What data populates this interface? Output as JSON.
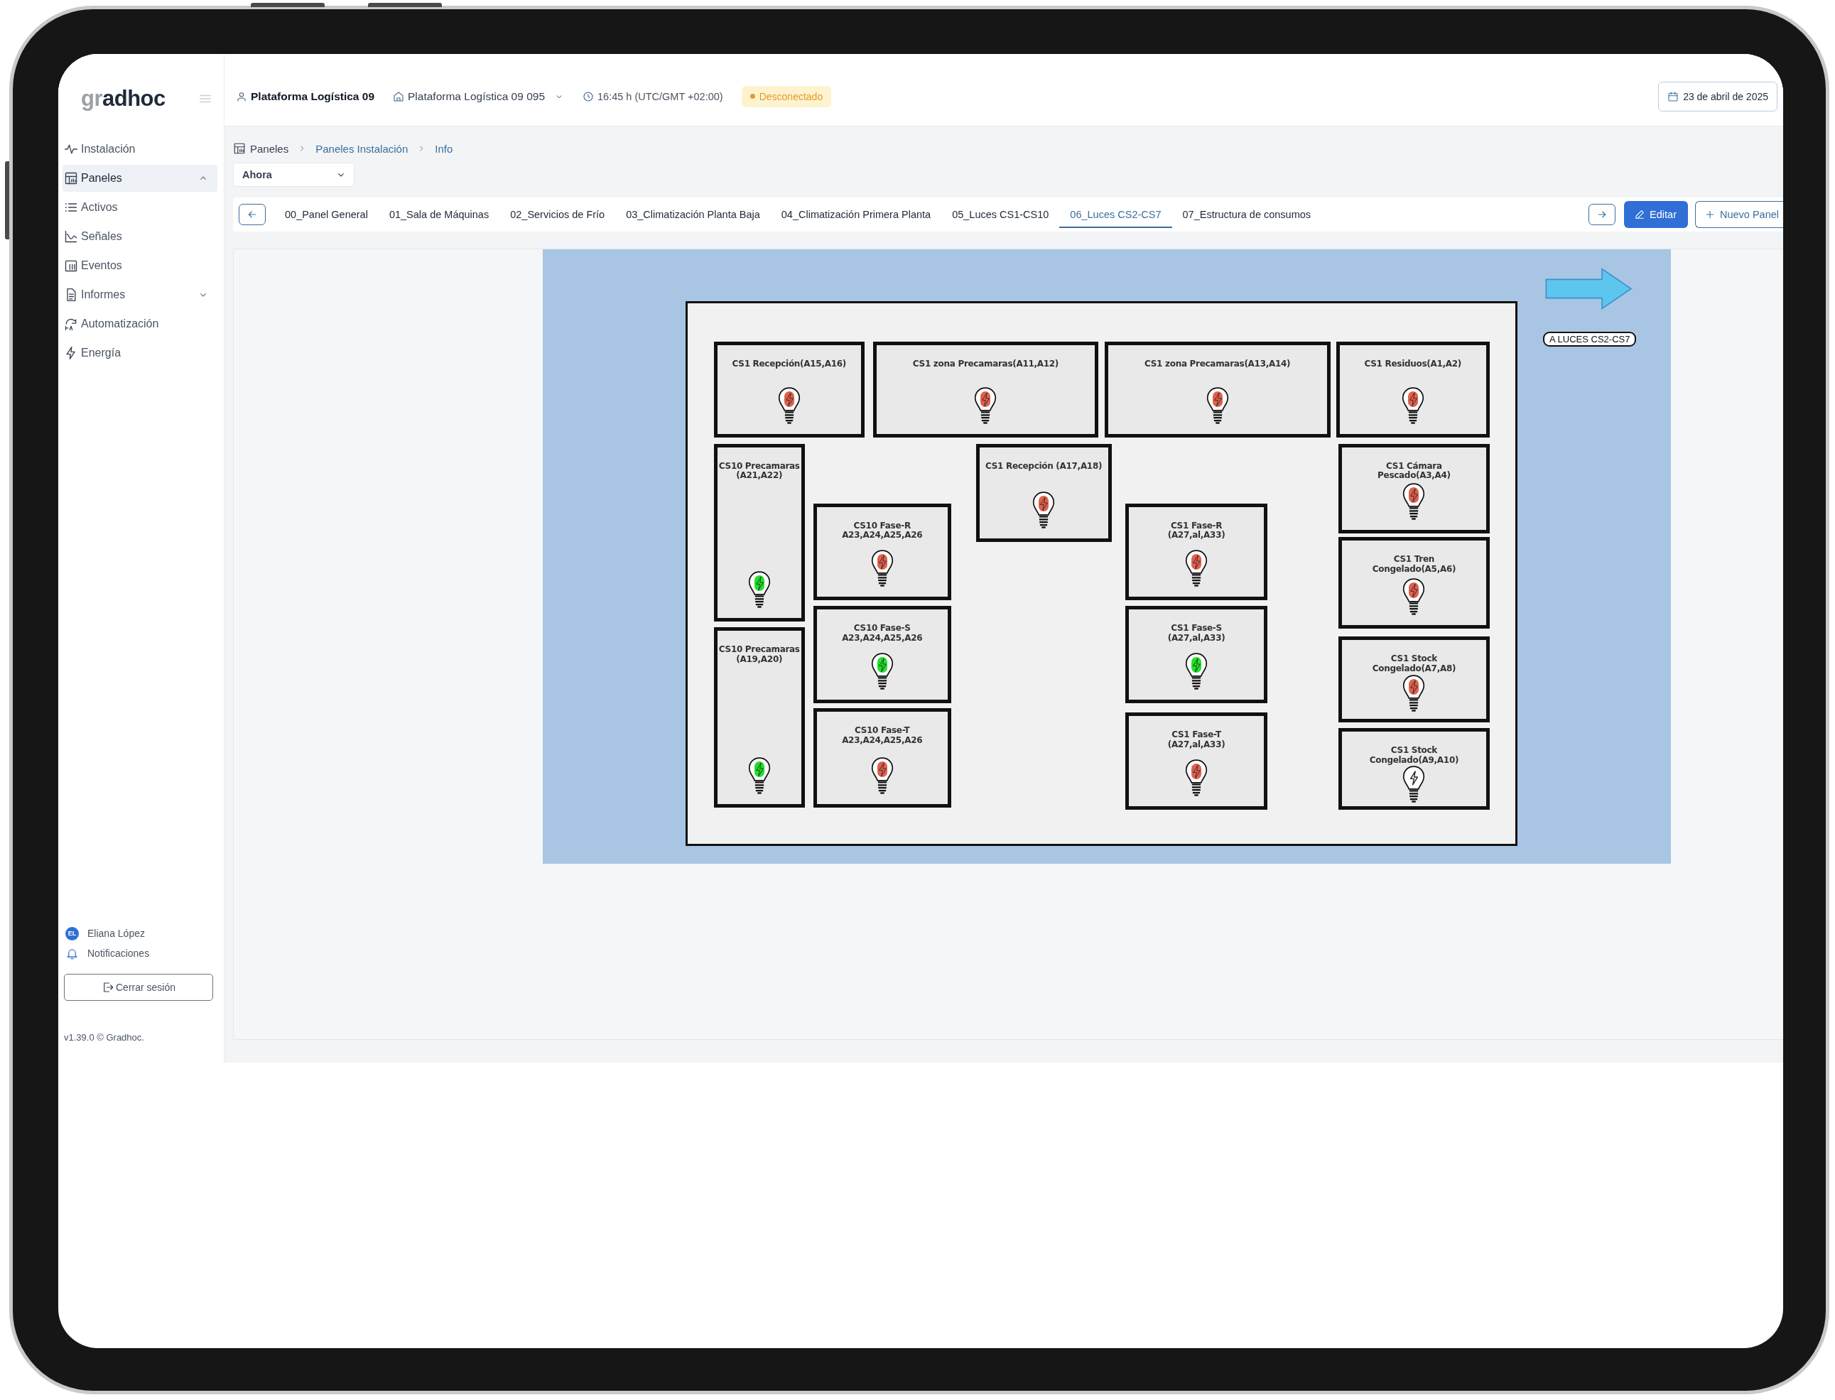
{
  "logo": [
    "gr",
    "adhoc"
  ],
  "sidebar": {
    "items": [
      {
        "label": "Instalación",
        "kind": "link",
        "selected": false
      },
      {
        "label": "Paneles",
        "kind": "group",
        "selected": true,
        "expanded": true
      },
      {
        "label": "Activos",
        "kind": "link",
        "selected": false
      },
      {
        "label": "Señales",
        "kind": "link",
        "selected": false
      },
      {
        "label": "Eventos",
        "kind": "link",
        "selected": false
      },
      {
        "label": "Informes",
        "kind": "group",
        "selected": false,
        "expanded": false
      },
      {
        "label": "Automatización",
        "kind": "link",
        "selected": false
      },
      {
        "label": "Energía",
        "kind": "link",
        "selected": false
      }
    ],
    "user": {
      "initials": "EL",
      "name": "Eliana López"
    },
    "notifications": "Notificaciones",
    "logout": "Cerrar sesión",
    "version": "v1.39.0 © Gradhoc."
  },
  "header": {
    "site": "Plataforma Logística 09",
    "subsite": "Plataforma Logística 09 095",
    "time": "16:45 h (UTC/GMT +02:00)",
    "connection": {
      "label": "Desconectado",
      "connected": false
    },
    "date": "23 de abril de 2025"
  },
  "breadcrumb": [
    "Paneles",
    "Paneles Instalación",
    "Info"
  ],
  "range_select": {
    "value": "Ahora"
  },
  "panel_tabs": [
    {
      "label": "00_Panel General",
      "selected": false
    },
    {
      "label": "01_Sala de Máquinas",
      "selected": false
    },
    {
      "label": "02_Servicios de Frío",
      "selected": false
    },
    {
      "label": "03_Climatización Planta Baja",
      "selected": false
    },
    {
      "label": "04_Climatización Primera Planta",
      "selected": false
    },
    {
      "label": "05_Luces CS1-CS10",
      "selected": false
    },
    {
      "label": "06_Luces CS2-CS7",
      "selected": true
    },
    {
      "label": "07_Estructura de consumos",
      "selected": false
    }
  ],
  "actions": {
    "edit": "Editar",
    "new": "Nuevo Panel"
  },
  "diagram": {
    "boxes": [
      {
        "label": "CS1 Recepción(A15,A16)",
        "color": "#e0604e"
      },
      {
        "label": "CS1 zona Precamaras(A11,A12)",
        "color": "#e0604e"
      },
      {
        "label": "CS1 zona Precamaras(A13,A14)",
        "color": "#e0604e"
      },
      {
        "label": "CS1 Residuos(A1,A2)",
        "color": "#e0604e"
      },
      {
        "label": "CS10 Precamaras\n(A21,A22)",
        "color": "#22e02a"
      },
      {
        "label": "CS10 Precamaras\n(A19,A20)",
        "color": "#22e02a"
      },
      {
        "label": "CS10 Fase-R\nA23,A24,A25,A26",
        "color": "#e0604e"
      },
      {
        "label": "CS10 Fase-S\nA23,A24,A25,A26",
        "color": "#22e02a"
      },
      {
        "label": "CS10 Fase-T\nA23,A24,A25,A26",
        "color": "#e0604e"
      },
      {
        "label": "CS1 Recepción (A17,A18)",
        "color": "#e0604e"
      },
      {
        "label": "CS1 Fase-R\n(A27,al,A33)",
        "color": "#e0604e"
      },
      {
        "label": "CS1 Fase-S\n(A27,al,A33)",
        "color": "#22e02a"
      },
      {
        "label": "CS1 Fase-T\n(A27,al,A33)",
        "color": "#e0604e"
      },
      {
        "label": "CS1 Cámara\nPescado(A3,A4)",
        "color": "#e0604e"
      },
      {
        "label": "CS1 Tren\nCongelado(A5,A6)",
        "color": "#e0604e"
      },
      {
        "label": "CS1 Stock\nCongelado(A7,A8)",
        "color": "#e0604e"
      },
      {
        "label": "CS1 Stock\nCongelado(A9,A10)"
      }
    ],
    "link": {
      "label": "A LUCES CS2-CS7"
    }
  }
}
